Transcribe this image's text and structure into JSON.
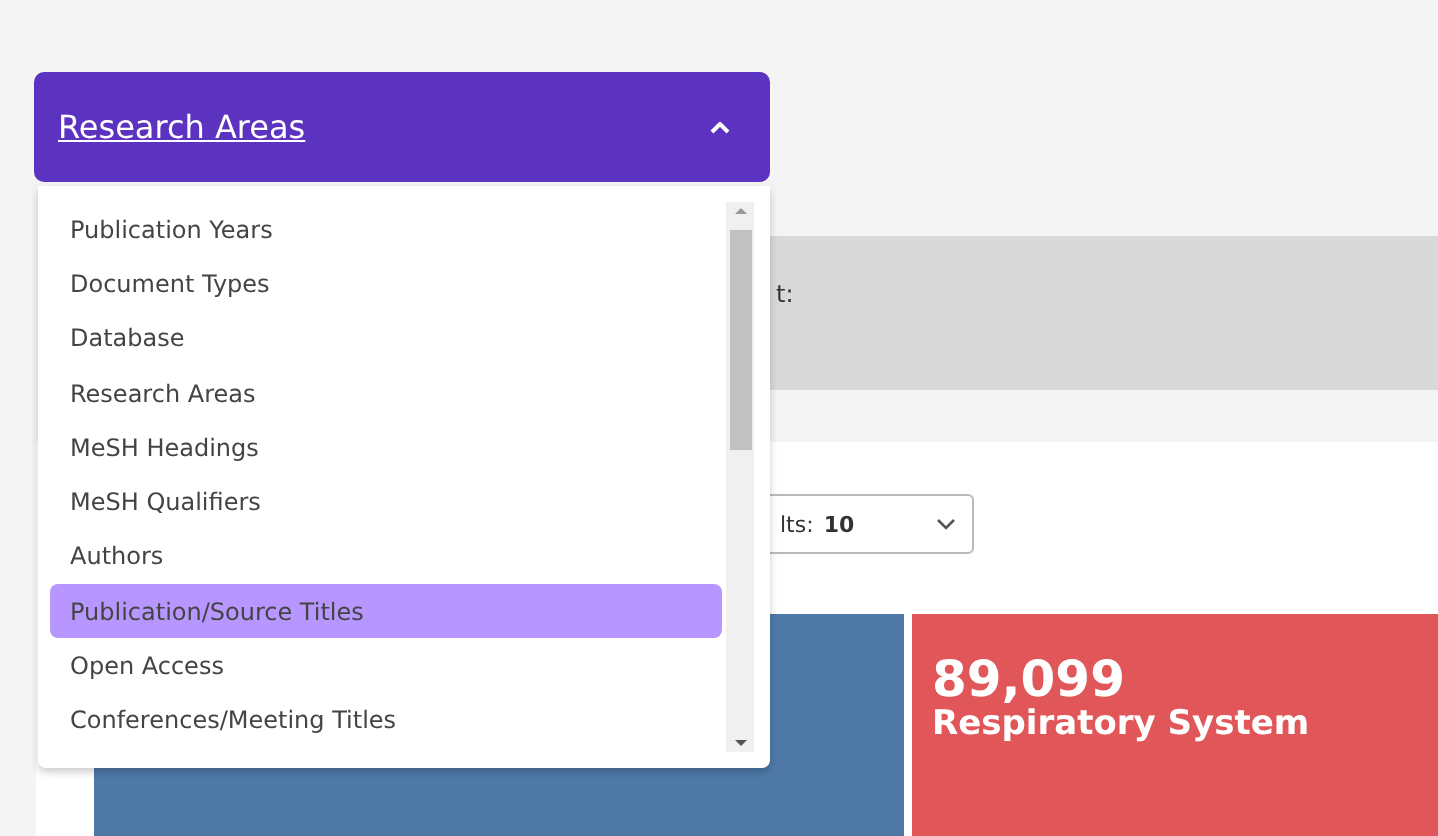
{
  "dropdown": {
    "title": "Research Areas",
    "expanded": true,
    "options": [
      {
        "label": "Publication Years",
        "selected": false
      },
      {
        "label": "Document Types",
        "selected": false
      },
      {
        "label": "Database",
        "selected": false
      },
      {
        "label": "Research Areas",
        "selected": false
      },
      {
        "label": "MeSH Headings",
        "selected": false
      },
      {
        "label": "MeSH Qualifiers",
        "selected": false
      },
      {
        "label": "Authors",
        "selected": false
      },
      {
        "label": "Publication/Source Titles",
        "selected": true
      },
      {
        "label": "Open Access",
        "selected": false
      },
      {
        "label": "Conferences/Meeting Titles",
        "selected": false
      }
    ]
  },
  "info_band": {
    "label": "t:"
  },
  "results_select": {
    "label": "lts:",
    "value": "10"
  },
  "treemap": [
    {
      "color": "#4e79a7"
    },
    {
      "value": "89,099",
      "label": "Respiratory System",
      "color": "#e15759"
    }
  ]
}
